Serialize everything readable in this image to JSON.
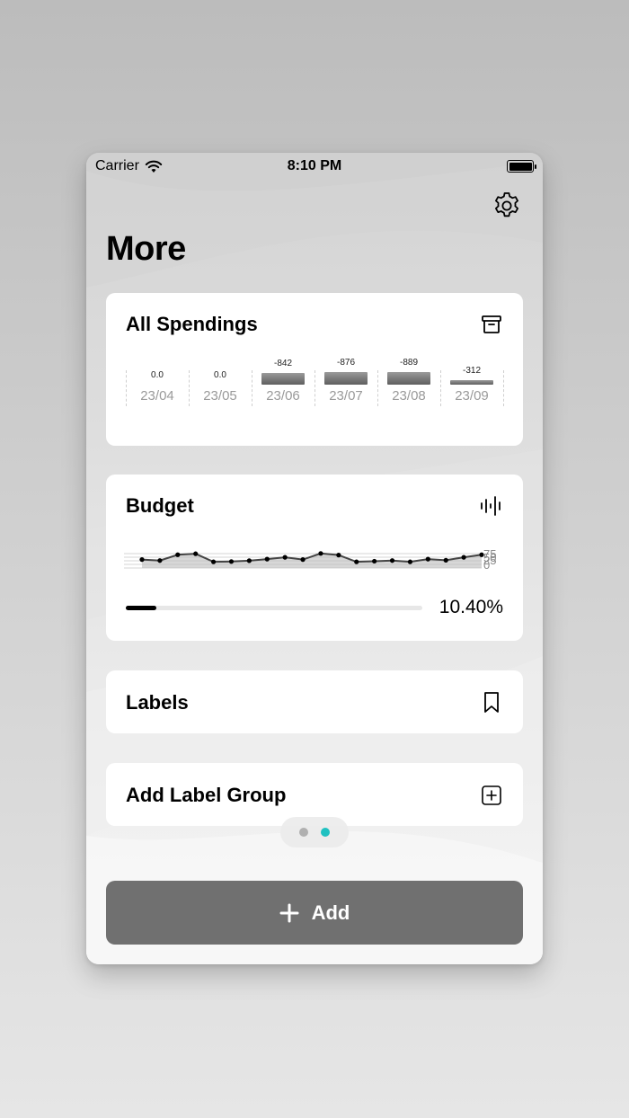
{
  "status_bar": {
    "carrier": "Carrier",
    "time": "8:10 PM"
  },
  "header": {
    "title": "More",
    "settings_icon": "gear-icon"
  },
  "spendings": {
    "title": "All Spendings",
    "icon": "archive-box-icon",
    "columns": [
      {
        "label": "0.0",
        "date": "23/04",
        "value": 0.0
      },
      {
        "label": "0.0",
        "date": "23/05",
        "value": 0.0
      },
      {
        "label": "-842",
        "date": "23/06",
        "value": -842
      },
      {
        "label": "-876",
        "date": "23/07",
        "value": -876
      },
      {
        "label": "-889",
        "date": "23/08",
        "value": -889
      },
      {
        "label": "-312",
        "date": "23/09",
        "value": -312
      }
    ]
  },
  "budget": {
    "title": "Budget",
    "icon": "waveform-icon",
    "axis_labels": [
      "75",
      "50",
      "25",
      "0"
    ],
    "series": [
      0.52,
      0.46,
      0.82,
      0.88,
      0.38,
      0.4,
      0.45,
      0.55,
      0.66,
      0.52,
      0.9,
      0.8,
      0.38,
      0.42,
      0.46,
      0.38,
      0.55,
      0.48,
      0.66,
      0.82
    ],
    "progress_fraction": 0.104,
    "progress_label": "10.40%"
  },
  "labels": {
    "title": "Labels",
    "icon": "bookmark-icon"
  },
  "add_label_group": {
    "title": "Add Label Group",
    "icon": "plus-square-icon"
  },
  "pager": {
    "count": 2,
    "active_index": 1,
    "active_color": "#1fc1c1",
    "inactive_color": "#b0b0b0"
  },
  "add_button": {
    "label": "Add",
    "icon": "plus-icon",
    "color": "#707070"
  }
}
